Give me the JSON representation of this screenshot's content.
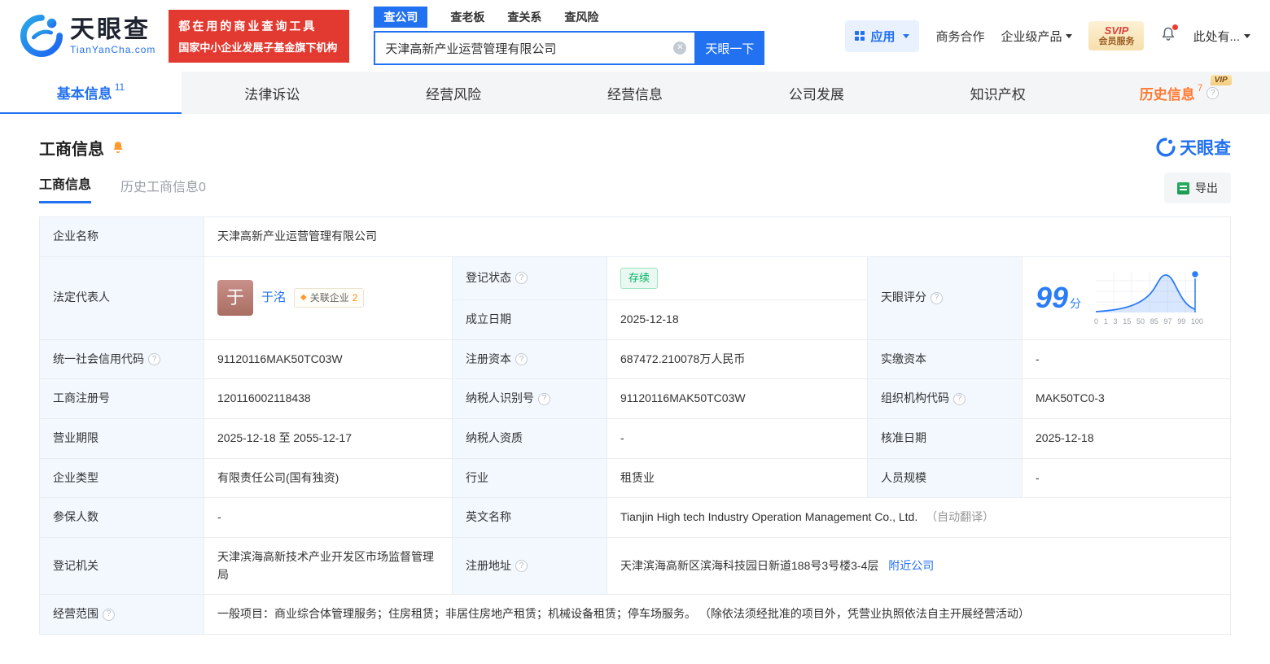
{
  "brand": {
    "name": "天眼查",
    "domain": "TianYanCha.com"
  },
  "header": {
    "promo_line1": "都在用的商业查询工具",
    "promo_line2": "国家中小企业发展子基金旗下机构",
    "search_tabs": [
      {
        "label": "查公司"
      },
      {
        "label": "查老板"
      },
      {
        "label": "查关系"
      },
      {
        "label": "查风险"
      }
    ],
    "search_value": "天津高新产业运营管理有限公司",
    "search_button": "天眼一下",
    "apps_label": "应用",
    "cooperation": "商务合作",
    "enterprise": "企业级产品",
    "svip_top": "SVIP",
    "svip_bottom": "会员服务",
    "user_label": "此处有..."
  },
  "nav": {
    "tabs": [
      {
        "label": "基本信息",
        "count": "11"
      },
      {
        "label": "法律诉讼"
      },
      {
        "label": "经营风险"
      },
      {
        "label": "经营信息"
      },
      {
        "label": "公司发展"
      },
      {
        "label": "知识产权"
      },
      {
        "label": "历史信息",
        "count": "7",
        "vip": "VIP"
      }
    ]
  },
  "section": {
    "title": "工商信息",
    "watermark": "天眼查",
    "subtab_active": "工商信息",
    "subtab_history": "历史工商信息0",
    "export_label": "导出"
  },
  "table": {
    "name": {
      "label": "企业名称",
      "value": "天津高新产业运营管理有限公司"
    },
    "legal": {
      "label": "法定代表人",
      "avatar": "于",
      "person": "于洺",
      "badge": "关联企业",
      "badge_count": "2"
    },
    "status": {
      "label": "登记状态",
      "value": "存续"
    },
    "established": {
      "label": "成立日期",
      "value": "2025-12-18"
    },
    "score": {
      "label": "天眼评分",
      "value": "99",
      "unit": "分",
      "ticks": [
        "0",
        "1",
        "3",
        "15",
        "50",
        "85",
        "97",
        "99",
        "100"
      ]
    },
    "credit_code": {
      "label": "统一社会信用代码",
      "value": "91120116MAK50TC03W"
    },
    "reg_capital": {
      "label": "注册资本",
      "value": "687472.210078万人民币"
    },
    "paid_capital": {
      "label": "实缴资本",
      "value": "-"
    },
    "reg_no": {
      "label": "工商注册号",
      "value": "120116002118438"
    },
    "taxpayer_id": {
      "label": "纳税人识别号",
      "value": "91120116MAK50TC03W"
    },
    "org_code": {
      "label": "组织机构代码",
      "value": "MAK50TC0-3"
    },
    "term": {
      "label": "营业期限",
      "value": "2025-12-18 至 2055-12-17"
    },
    "taxpayer_qualification": {
      "label": "纳税人资质",
      "value": "-"
    },
    "approved_date": {
      "label": "核准日期",
      "value": "2025-12-18"
    },
    "company_type": {
      "label": "企业类型",
      "value": "有限责任公司(国有独资)"
    },
    "industry": {
      "label": "行业",
      "value": "租赁业"
    },
    "staff_size": {
      "label": "人员规模",
      "value": "-"
    },
    "insured_count": {
      "label": "参保人数",
      "value": "-"
    },
    "english_name": {
      "label": "英文名称",
      "value": "Tianjin High tech Industry Operation Management Co., Ltd.",
      "note": "（自动翻译）"
    },
    "registry": {
      "label": "登记机关",
      "value": "天津滨海高新技术产业开发区市场监督管理局"
    },
    "address": {
      "label": "注册地址",
      "value": "天津滨海高新区滨海科技园日新道188号3号楼3-4层",
      "link": "附近公司"
    },
    "scope": {
      "label": "经营范围",
      "value": "一般项目：商业综合体管理服务；住房租赁；非居住房地产租赁；机械设备租赁；停车场服务。 （除依法须经批准的项目外，凭营业执照依法自主开展经营活动）"
    }
  }
}
